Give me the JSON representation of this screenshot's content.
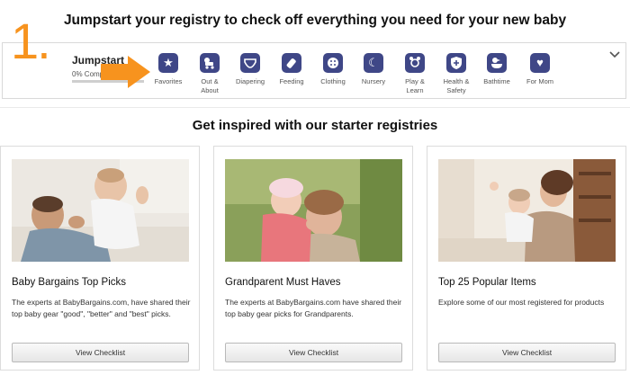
{
  "header": {
    "title": "Jumpstart your registry to check off everything you need for your new baby"
  },
  "checklist": {
    "step_number": "1.",
    "title": "Jumpstart",
    "progress_text": "0% Complete",
    "progress_percent": 0,
    "categories": [
      {
        "label": "Favorites",
        "icon": "star-icon"
      },
      {
        "label": "Out & About",
        "icon": "stroller-icon"
      },
      {
        "label": "Diapering",
        "icon": "diaper-icon"
      },
      {
        "label": "Feeding",
        "icon": "bottle-icon"
      },
      {
        "label": "Clothing",
        "icon": "button-icon"
      },
      {
        "label": "Nursery",
        "icon": "moon-icon"
      },
      {
        "label": "Play & Learn",
        "icon": "rattle-icon"
      },
      {
        "label": "Health & Safety",
        "icon": "shield-icon"
      },
      {
        "label": "Bathtime",
        "icon": "duck-icon"
      },
      {
        "label": "For Mom",
        "icon": "heart-icon"
      }
    ]
  },
  "section": {
    "title": "Get inspired with our starter registries"
  },
  "cards": [
    {
      "title": "Baby Bargains Top Picks",
      "description": "The experts at BabyBargains.com, have shared their top baby gear \"good\", \"better\" and \"best\" picks.",
      "button": "View Checklist"
    },
    {
      "title": "Grandparent Must Haves",
      "description": "The experts at BabyBargains.com have shared their top baby gear picks for Grandparents.",
      "button": "View Checklist"
    },
    {
      "title": "Top 25 Popular Items",
      "description": "Explore some of our most registered for products",
      "button": "View Checklist"
    }
  ],
  "colors": {
    "accent_orange": "#f7931e",
    "icon_navy": "#3f4787"
  }
}
